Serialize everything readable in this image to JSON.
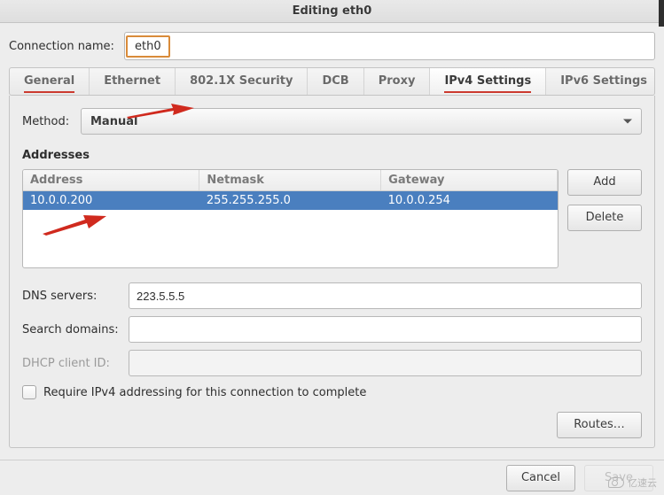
{
  "window": {
    "title": "Editing eth0"
  },
  "connection": {
    "label": "Connection name:",
    "value": "eth0"
  },
  "tabs": {
    "general": "General",
    "ethernet": "Ethernet",
    "security": "802.1X Security",
    "dcb": "DCB",
    "proxy": "Proxy",
    "ipv4": "IPv4 Settings",
    "ipv6": "IPv6 Settings"
  },
  "method": {
    "label": "Method:",
    "value": "Manual"
  },
  "addresses": {
    "heading": "Addresses",
    "columns": {
      "address": "Address",
      "netmask": "Netmask",
      "gateway": "Gateway"
    },
    "rows": [
      {
        "address": "10.0.0.200",
        "netmask": "255.255.255.0",
        "gateway": "10.0.0.254"
      }
    ],
    "add": "Add",
    "delete": "Delete"
  },
  "dns": {
    "label": "DNS servers:",
    "value": "223.5.5.5"
  },
  "search": {
    "label": "Search domains:",
    "value": ""
  },
  "dhcp": {
    "label": "DHCP client ID:",
    "value": ""
  },
  "require": {
    "label": "Require IPv4 addressing for this connection to complete",
    "checked": false
  },
  "routes": {
    "label": "Routes…"
  },
  "footer": {
    "cancel": "Cancel",
    "save": "Save"
  },
  "watermark": {
    "text": "亿速云"
  }
}
